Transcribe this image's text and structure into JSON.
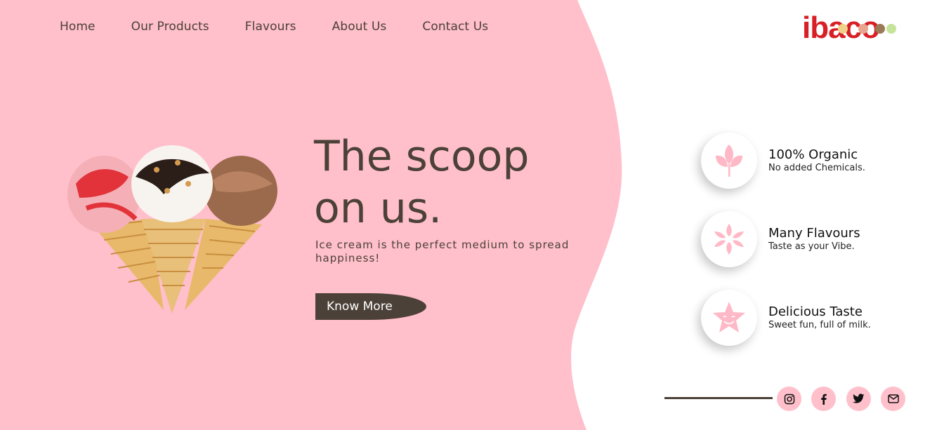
{
  "nav": {
    "items": [
      "Home",
      "Our Products",
      "Flavours",
      "About Us",
      "Contact Us"
    ]
  },
  "logo": {
    "text": "ibaco",
    "color": "#d81f26"
  },
  "colors": {
    "pink": "#ffbfcb",
    "dark": "#4b4138",
    "icon_pink": "#ffb8c6"
  },
  "hero": {
    "title_line1": "The scoop",
    "title_line2": "on us.",
    "subtitle": "Ice cream is the perfect medium to spread happiness!",
    "button_label": "Know More"
  },
  "features": [
    {
      "title": "100% Organic",
      "desc": "No added Chemicals.",
      "icon": "leaf-icon"
    },
    {
      "title": "Many Flavours",
      "desc": "Taste as your Vibe.",
      "icon": "flower-icon"
    },
    {
      "title": "Delicious Taste",
      "desc": "Sweet fun, full of milk.",
      "icon": "star-face-icon"
    }
  ],
  "social": [
    "instagram-icon",
    "facebook-icon",
    "twitter-icon",
    "mail-icon"
  ]
}
